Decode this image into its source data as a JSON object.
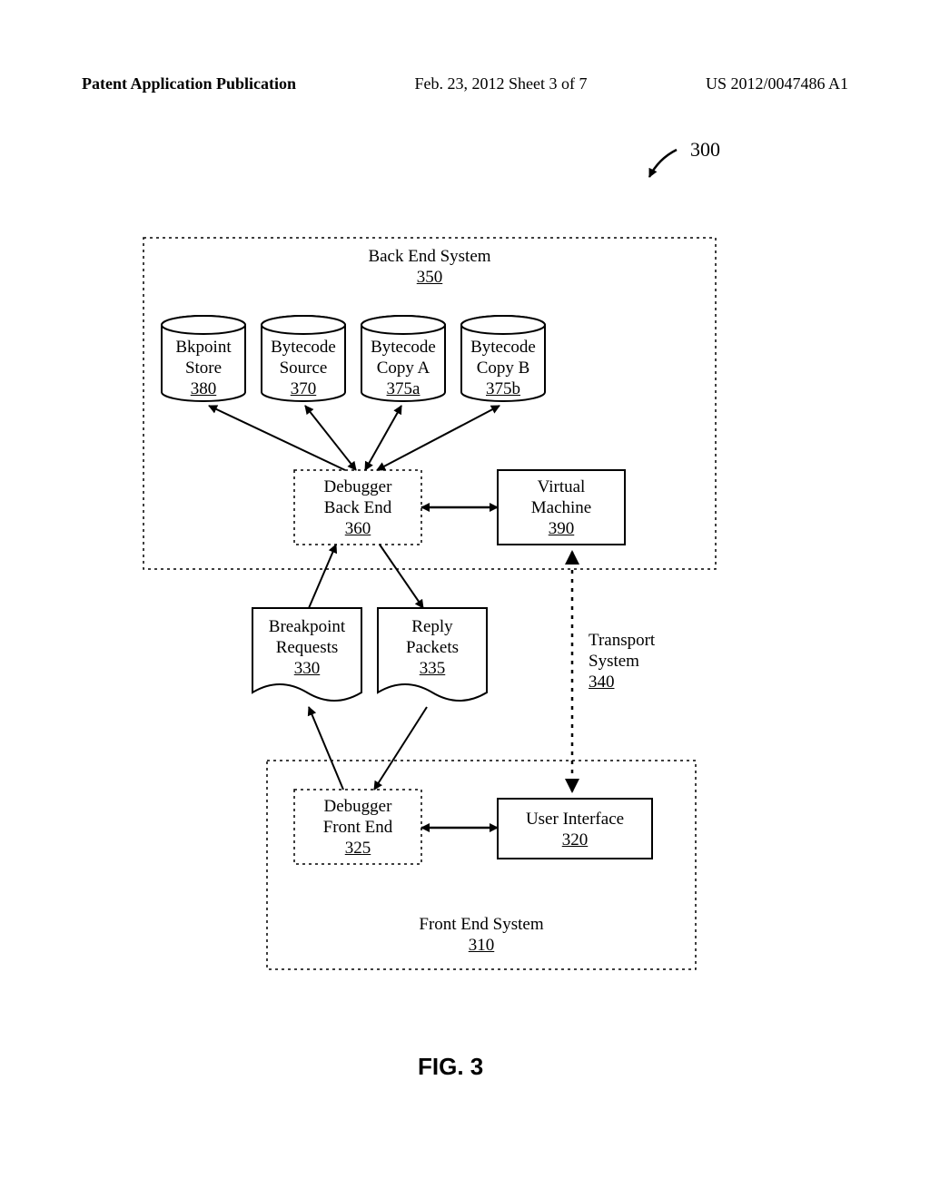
{
  "header": {
    "left": "Patent Application Publication",
    "center": "Feb. 23, 2012  Sheet 3 of 7",
    "right": "US 2012/0047486 A1"
  },
  "ref": {
    "label": "300"
  },
  "backend": {
    "title": "Back End System",
    "ref": "350",
    "bkpoint": {
      "l1": "Bkpoint",
      "l2": "Store",
      "ref": "380"
    },
    "source": {
      "l1": "Bytecode",
      "l2": "Source",
      "ref": "370"
    },
    "copyA": {
      "l1": "Bytecode",
      "l2": "Copy A",
      "ref": "375a"
    },
    "copyB": {
      "l1": "Bytecode",
      "l2": "Copy B",
      "ref": "375b"
    },
    "debugger": {
      "l1": "Debugger",
      "l2": "Back End",
      "ref": "360"
    },
    "vm": {
      "l1": "Virtual",
      "l2": "Machine",
      "ref": "390"
    }
  },
  "transport": {
    "req": {
      "l1": "Breakpoint",
      "l2": "Requests",
      "ref": "330"
    },
    "reply": {
      "l1": "Reply",
      "l2": "Packets",
      "ref": "335"
    },
    "label": {
      "l1": "Transport",
      "l2": "System",
      "ref": "340"
    }
  },
  "frontend": {
    "title": "Front End System",
    "ref": "310",
    "debugger": {
      "l1": "Debugger",
      "l2": "Front End",
      "ref": "325"
    },
    "ui": {
      "l1": "User Interface",
      "ref": "320"
    }
  },
  "figure": {
    "label": "FIG. 3"
  }
}
